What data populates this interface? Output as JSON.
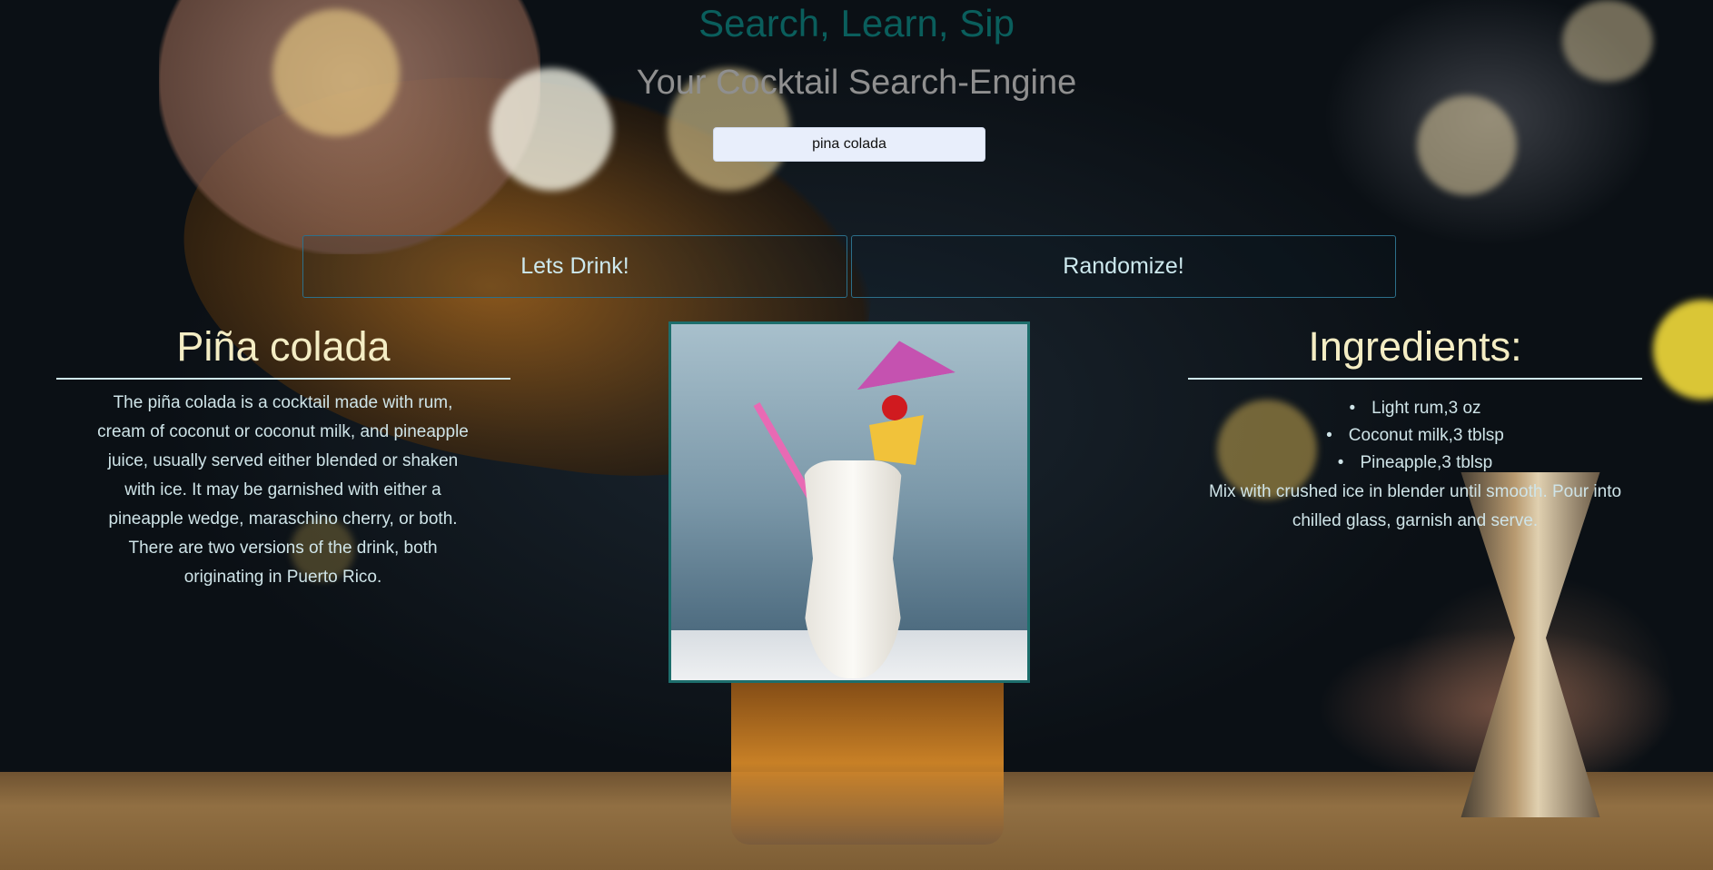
{
  "header": {
    "title": "Search, Learn, Sip",
    "subtitle": "Your Cocktail Search-Engine"
  },
  "search": {
    "value": "pina colada"
  },
  "buttons": {
    "drink_label": "Lets Drink!",
    "random_label": "Randomize!"
  },
  "drink": {
    "name": "Piña colada",
    "description": "The piña colada is a cocktail made with rum, cream of coconut or coconut milk, and pineapple juice, usually served either blended or shaken with ice. It may be garnished with either a pineapple wedge, maraschino cherry, or both. There are two versions of the drink, both originating in Puerto Rico.",
    "image_alt": "Piña colada"
  },
  "ingredients": {
    "heading": "Ingredients:",
    "items": [
      "Light rum,3 oz",
      "Coconut milk,3 tblsp",
      "Pineapple,3 tblsp"
    ],
    "instructions": "Mix with crushed ice in blender until smooth. Pour into chilled glass, garnish and serve."
  },
  "colors": {
    "title": "#0a5e5c",
    "subtitle": "#8f8f8f",
    "heading": "#f4edc4",
    "body_text": "#cfe4e8",
    "button_border": "#2c6f8a"
  }
}
